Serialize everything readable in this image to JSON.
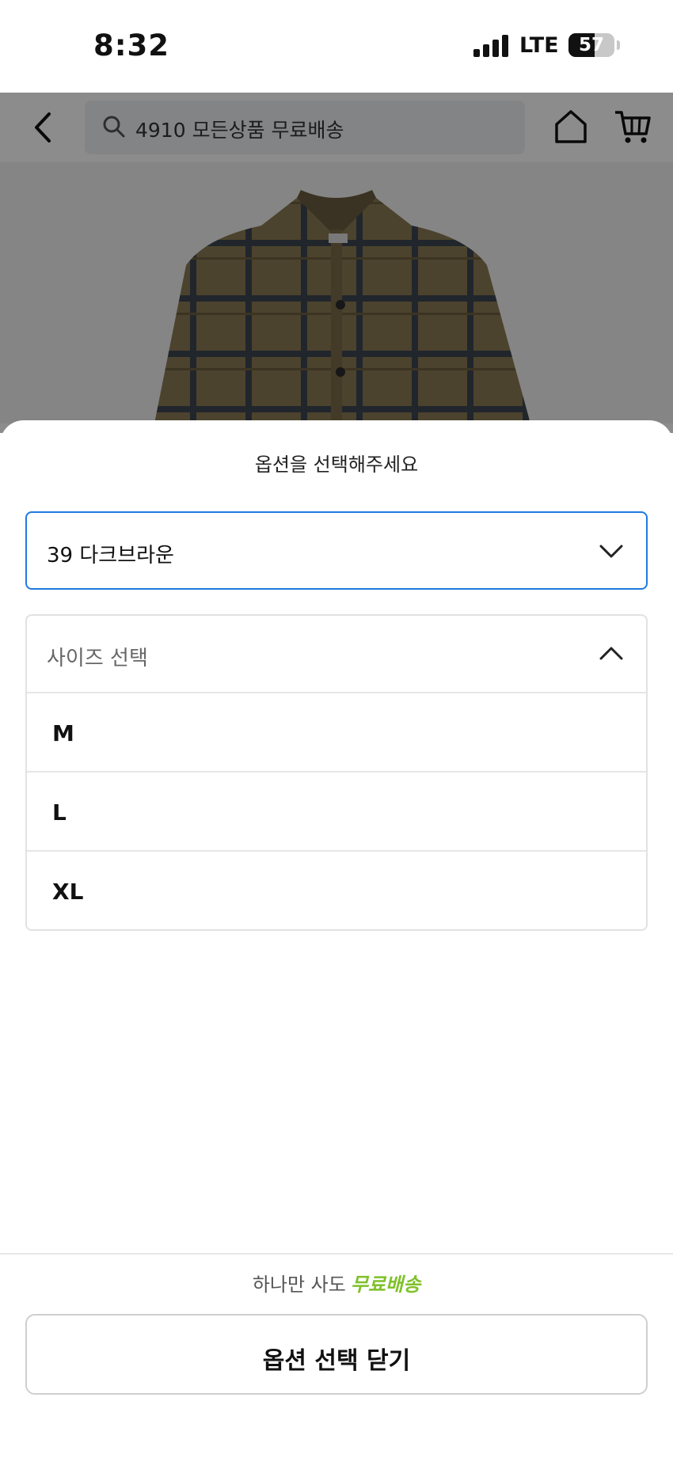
{
  "status_bar": {
    "time": "8:32",
    "network": "LTE",
    "battery_percent": "57",
    "battery_level": 0.57
  },
  "header": {
    "search_text": "4910 모든상품 무료배송",
    "icons": [
      "back-icon",
      "search-icon",
      "home-icon",
      "cart-icon"
    ]
  },
  "sheet": {
    "title": "옵션을 선택해주세요",
    "color_select": {
      "value": "39 다크브라운",
      "icon": "chevron-down-icon"
    },
    "size_select": {
      "label": "사이즈 선택",
      "icon": "chevron-up-icon",
      "options": [
        "M",
        "L",
        "XL"
      ]
    },
    "promo": {
      "text": "하나만 사도",
      "highlight": "무료배송",
      "highlight_color": "#7fc12a"
    },
    "close_button": "옵션 선택 닫기"
  },
  "colors": {
    "accent": "#1f7ae0",
    "promo": "#7fc12a"
  }
}
